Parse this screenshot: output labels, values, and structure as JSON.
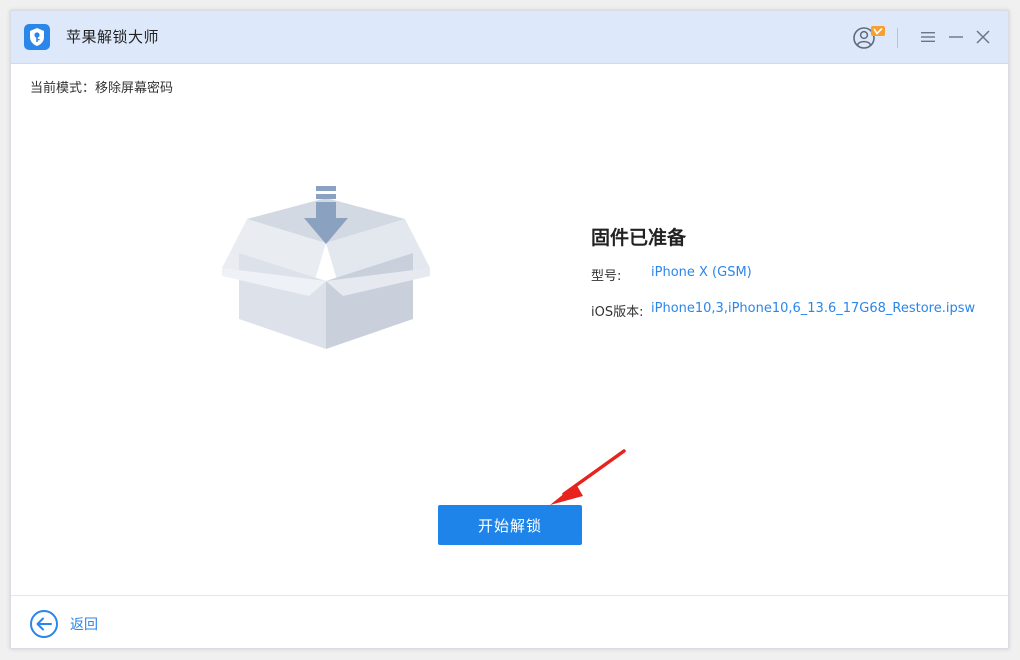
{
  "app": {
    "title": "苹果解锁大师"
  },
  "colors": {
    "accent": "#1f84ea",
    "titlebar": "#dde9fb",
    "badge": "#f5a030"
  },
  "mode": {
    "label": "当前模式：",
    "value": "移除屏幕密码"
  },
  "firmware": {
    "title": "固件已准备",
    "model_label": "型号:",
    "model_value": "iPhone X (GSM)",
    "ios_label": "iOS版本:",
    "ios_value": "iPhone10,3,iPhone10,6_13.6_17G68_Restore.ipsw"
  },
  "actions": {
    "start_label": "开始解锁",
    "back_label": "返回"
  },
  "icons": [
    "shield-key-icon",
    "user-vip-icon",
    "menu-icon",
    "minimize-icon",
    "close-icon",
    "firmware-box-icon",
    "back-arrow-icon"
  ]
}
